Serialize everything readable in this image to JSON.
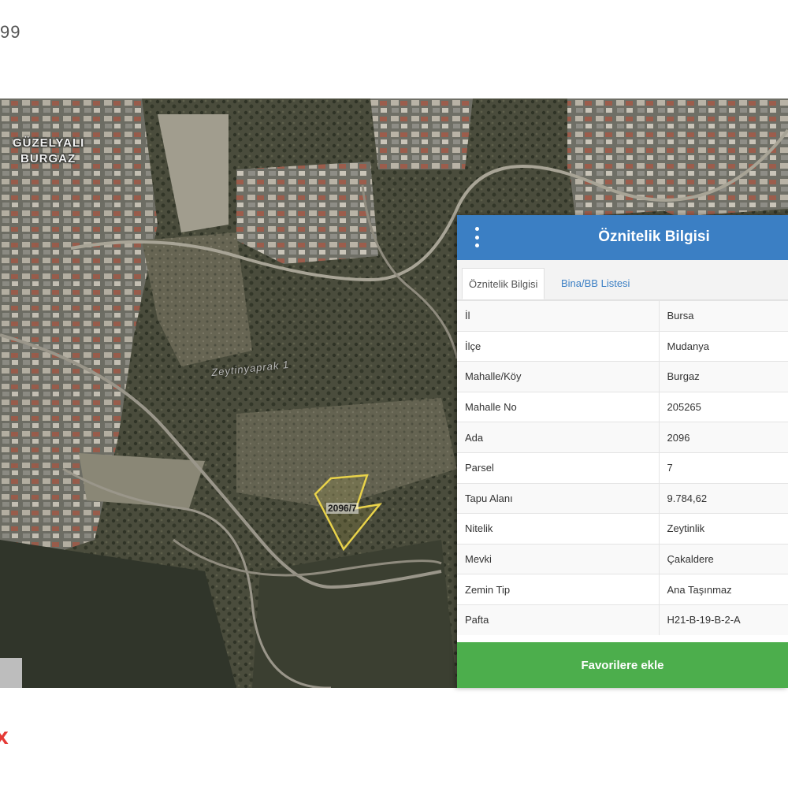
{
  "page": {
    "top_text": "99",
    "bottom_mark": "x"
  },
  "map": {
    "district_label_1": "GÜZELYALI",
    "district_label_2": "BURGAZ",
    "street_label": "Zeytinyaprak 1",
    "parcel_label": "2096/7",
    "parcel_color": "#e8d24a"
  },
  "panel": {
    "title": "Öznitelik Bilgisi",
    "menu_icon": "vertical-dots-icon",
    "header_color": "#3b7fc4",
    "tabs": [
      {
        "label": "Öznitelik Bilgisi",
        "active": true
      },
      {
        "label": "Bina/BB Listesi",
        "active": false
      }
    ],
    "rows": [
      {
        "key": "İl",
        "value": "Bursa"
      },
      {
        "key": "İlçe",
        "value": "Mudanya"
      },
      {
        "key": "Mahalle/Köy",
        "value": "Burgaz"
      },
      {
        "key": "Mahalle No",
        "value": "205265"
      },
      {
        "key": "Ada",
        "value": "2096"
      },
      {
        "key": "Parsel",
        "value": "7"
      },
      {
        "key": "Tapu Alanı",
        "value": "9.784,62"
      },
      {
        "key": "Nitelik",
        "value": "Zeytinlik"
      },
      {
        "key": "Mevki",
        "value": "Çakaldere"
      },
      {
        "key": "Zemin Tip",
        "value": "Ana Taşınmaz"
      },
      {
        "key": "Pafta",
        "value": "H21-B-19-B-2-A"
      }
    ],
    "favorite_button": "Favorilere ekle",
    "button_color": "#4cae4c"
  }
}
